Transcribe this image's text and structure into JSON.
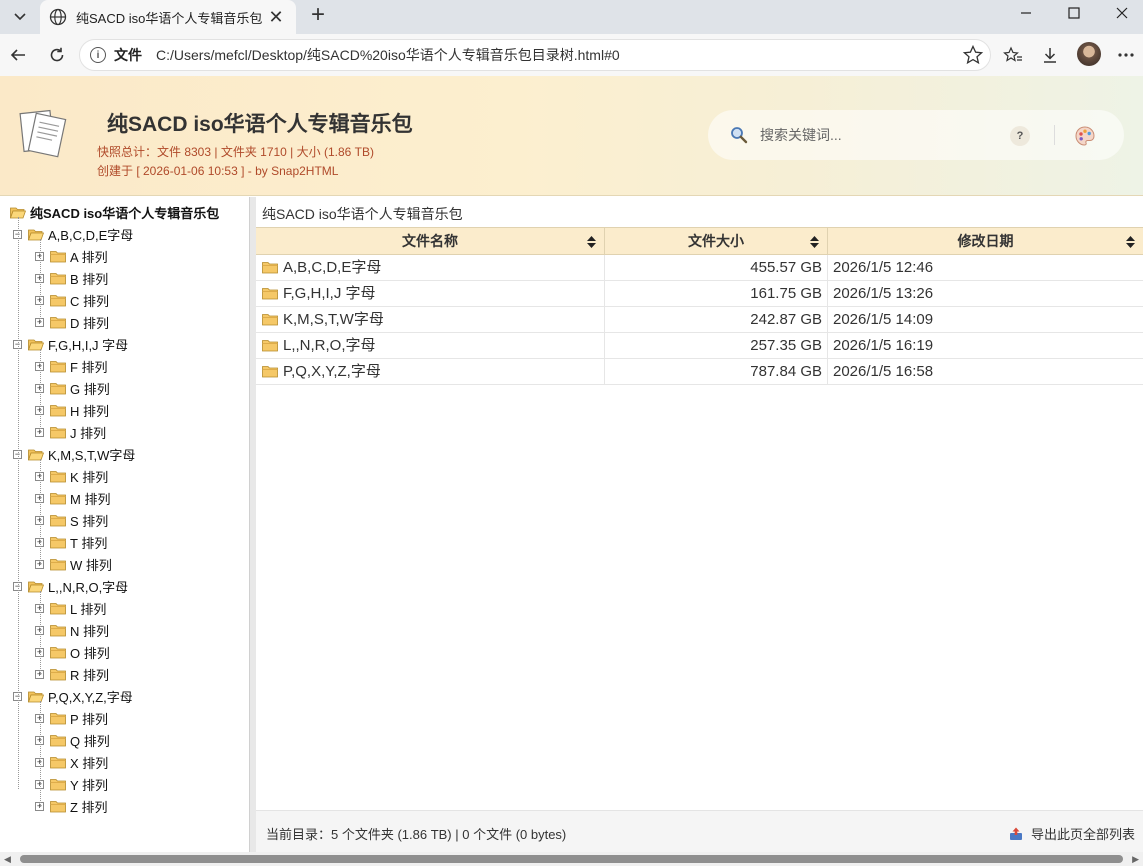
{
  "browser": {
    "tab_title": "纯SACD iso华语个人专辑音乐包",
    "url_scheme": "文件",
    "url_path": "C:/Users/mefcl/Desktop/纯SACD%20iso华语个人专辑音乐包目录树.html#0"
  },
  "header": {
    "title": "纯SACD iso华语个人专辑音乐包",
    "stats": "快照总计：文件 8303 | 文件夹 1710 | 大小 (1.86 TB)",
    "created": "创建于 [ 2026-01-06 10:53 ] - by Snap2HTML",
    "search_placeholder": "搜索关键词...",
    "help_label": "?"
  },
  "tree": {
    "root": "纯SACD iso华语个人专辑音乐包",
    "groups": [
      {
        "label": "A,B,C,D,E字母",
        "children": [
          "A 排列",
          "B 排列",
          "C 排列",
          "D 排列"
        ]
      },
      {
        "label": "F,G,H,I,J 字母",
        "children": [
          "F 排列",
          "G 排列",
          "H 排列",
          "J 排列"
        ]
      },
      {
        "label": "K,M,S,T,W字母",
        "children": [
          "K 排列",
          "M 排列",
          "S 排列",
          "T 排列",
          "W 排列"
        ]
      },
      {
        "label": "L,,N,R,O,字母",
        "children": [
          "L 排列",
          "N 排列",
          "O 排列",
          "R 排列"
        ]
      },
      {
        "label": "P,Q,X,Y,Z,字母",
        "children": [
          "P 排列",
          "Q 排列",
          "X 排列",
          "Y 排列",
          "Z 排列"
        ]
      }
    ]
  },
  "content": {
    "breadcrumb": "纯SACD iso华语个人专辑音乐包",
    "columns": [
      "文件名称",
      "文件大小",
      "修改日期"
    ],
    "rows": [
      {
        "name": "A,B,C,D,E字母",
        "size": "455.57 GB",
        "date": "2026/1/5 12:46"
      },
      {
        "name": "F,G,H,I,J 字母",
        "size": "161.75 GB",
        "date": "2026/1/5 13:26"
      },
      {
        "name": "K,M,S,T,W字母",
        "size": "242.87 GB",
        "date": "2026/1/5 14:09"
      },
      {
        "name": "L,,N,R,O,字母",
        "size": "257.35 GB",
        "date": "2026/1/5 16:19"
      },
      {
        "name": "P,Q,X,Y,Z,字母",
        "size": "787.84 GB",
        "date": "2026/1/5 16:58"
      }
    ],
    "status": "当前目录：5 个文件夹 (1.86 TB) | 0 个文件 (0 bytes)",
    "export_label": "导出此页全部列表"
  },
  "colors": {
    "header_gradient_start": "#fbe9c8",
    "accent_text": "#b04a2a",
    "folder": "#f2c35c",
    "column_header": "#fbeccc"
  }
}
